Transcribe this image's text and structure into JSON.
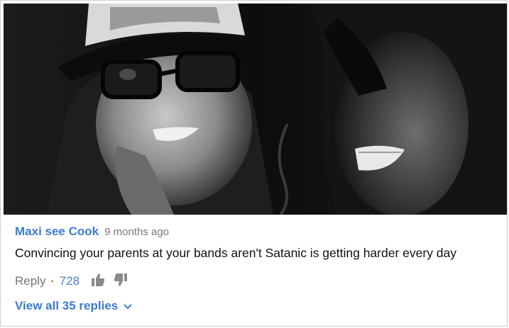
{
  "video": {
    "scene": "still-frame-two-faces"
  },
  "comment": {
    "author": "Maxi see Cook",
    "time": "9 months ago",
    "text": "Convincing your parents at your bands aren't Satanic is getting harder every day",
    "reply_label": "Reply",
    "separator": "•",
    "like_count": "728",
    "like_icon": "thumbs-up-icon",
    "dislike_icon": "thumbs-down-icon",
    "view_replies_label": "View all 35 replies",
    "expand_icon": "chevron-down-icon"
  },
  "colors": {
    "author": "#3b7bd4",
    "link": "#3b7bd4",
    "muted": "#767676",
    "text": "#111111"
  }
}
